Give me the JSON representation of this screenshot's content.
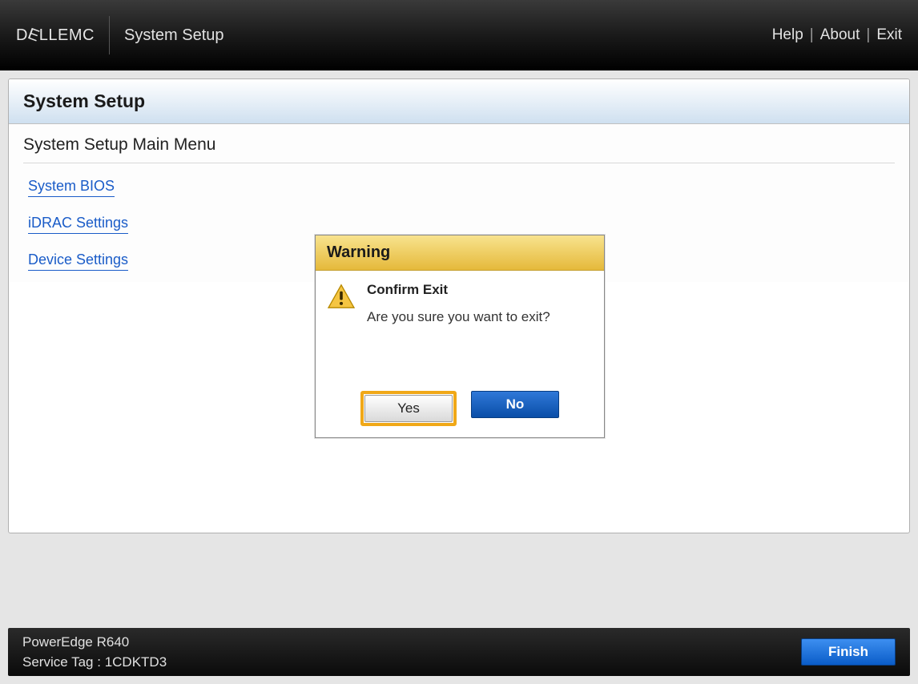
{
  "header": {
    "brand_dell": "D",
    "brand_e": "E",
    "brand_ll": "LL",
    "brand_emc": "EMC",
    "title": "System Setup",
    "links": {
      "help": "Help",
      "about": "About",
      "exit": "Exit"
    }
  },
  "panel": {
    "title": "System Setup",
    "menu_title": "System Setup Main Menu",
    "items": [
      {
        "label": "System BIOS"
      },
      {
        "label": "iDRAC Settings"
      },
      {
        "label": "Device Settings"
      }
    ]
  },
  "dialog": {
    "header": "Warning",
    "title": "Confirm Exit",
    "message": "Are you sure you want to exit?",
    "yes": "Yes",
    "no": "No"
  },
  "footer": {
    "model": "PowerEdge R640",
    "service_tag_label": "Service Tag :",
    "service_tag_value": "1CDKTD3",
    "finish": "Finish"
  }
}
